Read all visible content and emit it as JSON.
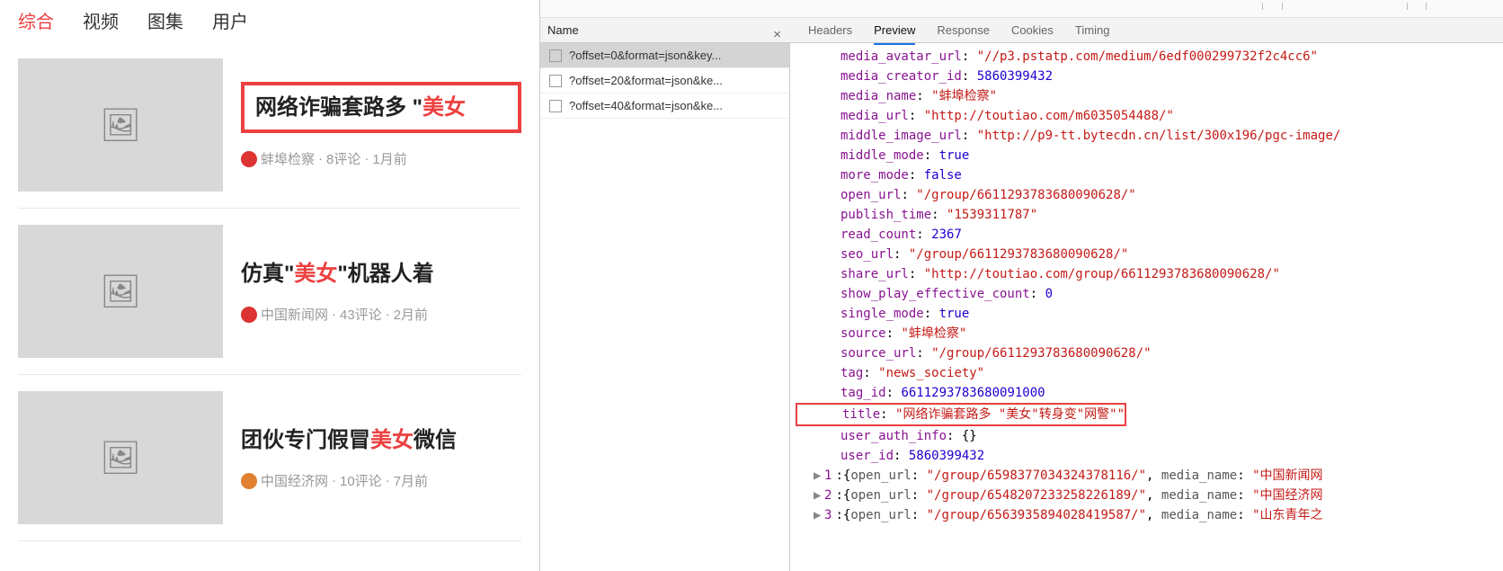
{
  "left": {
    "tabs": [
      "综合",
      "视频",
      "图集",
      "用户"
    ],
    "active_tab_index": 0,
    "articles": [
      {
        "title_pre": "网络诈骗套路多  \"",
        "title_hl": "美女",
        "boxed": true,
        "source": "蚌埠检察",
        "comments": "8评论",
        "time": "1月前",
        "src_icon": "red"
      },
      {
        "title_pre": "仿真\"",
        "title_hl": "美女",
        "title_post": "\"机器人着",
        "boxed": false,
        "source": "中国新闻网",
        "comments": "43评论",
        "time": "2月前",
        "src_icon": "red"
      },
      {
        "title_pre": "团伙专门假冒",
        "title_hl": "美女",
        "title_post": "微信",
        "boxed": false,
        "source": "中国经济网",
        "comments": "10评论",
        "time": "7月前",
        "src_icon": "orange"
      }
    ]
  },
  "devtools": {
    "name_header": "Name",
    "tabs": [
      "Headers",
      "Preview",
      "Response",
      "Cookies",
      "Timing"
    ],
    "active_tab_index": 1,
    "requests": [
      "?offset=0&format=json&key...",
      "?offset=20&format=json&ke...",
      "?offset=40&format=json&ke..."
    ],
    "selected_request_index": 0,
    "json_rows": [
      {
        "k": "media_avatar_url",
        "v": "\"//p3.pstatp.com/medium/6edf000299732f2c4cc6\"",
        "t": "str"
      },
      {
        "k": "media_creator_id",
        "v": "5860399432",
        "t": "num"
      },
      {
        "k": "media_name",
        "v": "\"蚌埠检察\"",
        "t": "str"
      },
      {
        "k": "media_url",
        "v": "\"http://toutiao.com/m6035054488/\"",
        "t": "str"
      },
      {
        "k": "middle_image_url",
        "v": "\"http://p9-tt.bytecdn.cn/list/300x196/pgc-image/",
        "t": "str"
      },
      {
        "k": "middle_mode",
        "v": "true",
        "t": "bool"
      },
      {
        "k": "more_mode",
        "v": "false",
        "t": "bool"
      },
      {
        "k": "open_url",
        "v": "\"/group/6611293783680090628/\"",
        "t": "str"
      },
      {
        "k": "publish_time",
        "v": "\"1539311787\"",
        "t": "str"
      },
      {
        "k": "read_count",
        "v": "2367",
        "t": "num"
      },
      {
        "k": "seo_url",
        "v": "\"/group/6611293783680090628/\"",
        "t": "str"
      },
      {
        "k": "share_url",
        "v": "\"http://toutiao.com/group/6611293783680090628/\"",
        "t": "str"
      },
      {
        "k": "show_play_effective_count",
        "v": "0",
        "t": "num"
      },
      {
        "k": "single_mode",
        "v": "true",
        "t": "bool"
      },
      {
        "k": "source",
        "v": "\"蚌埠检察\"",
        "t": "str"
      },
      {
        "k": "source_url",
        "v": "\"/group/6611293783680090628/\"",
        "t": "str"
      },
      {
        "k": "tag",
        "v": "\"news_society\"",
        "t": "str"
      },
      {
        "k": "tag_id",
        "v": "6611293783680091000",
        "t": "num"
      },
      {
        "k": "title",
        "v": "\"网络诈骗套路多 \"美女\"转身变\"网警\"\"",
        "t": "str",
        "boxed": true
      },
      {
        "k": "user_auth_info",
        "v": "{}",
        "t": "pun"
      },
      {
        "k": "user_id",
        "v": "5860399432",
        "t": "num"
      }
    ],
    "arr_rows": [
      {
        "idx": "1",
        "open_url": "\"/group/6598377034324378116/\"",
        "media_name": "\"中国新闻网"
      },
      {
        "idx": "2",
        "open_url": "\"/group/6548207233258226189/\"",
        "media_name": "\"中国经济网"
      },
      {
        "idx": "3",
        "open_url": "\"/group/6563935894028419587/\"",
        "media_name": "\"山东青年之"
      }
    ]
  }
}
